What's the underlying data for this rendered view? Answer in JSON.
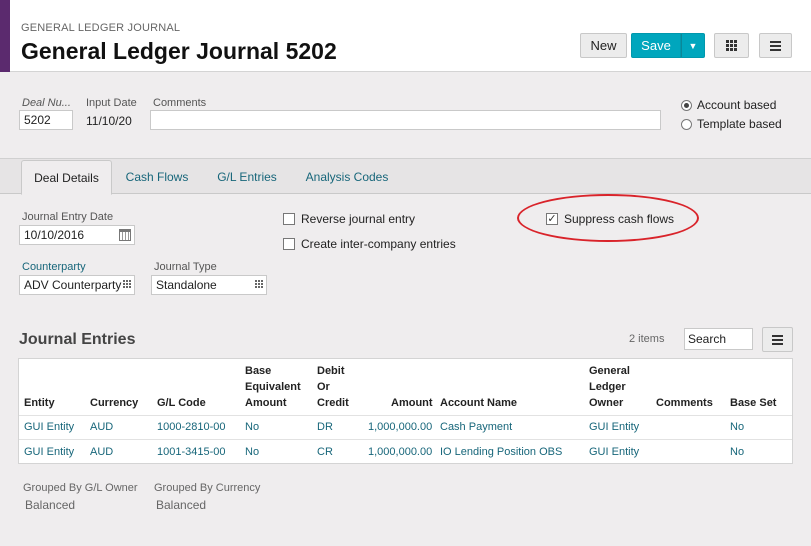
{
  "header": {
    "breadcrumb": "GENERAL LEDGER JOURNAL",
    "title": "General Ledger Journal 5202",
    "buttons": {
      "new": "New",
      "save": "Save"
    }
  },
  "form": {
    "deal_number_label": "Deal Nu...",
    "deal_number_value": "5202",
    "input_date_label": "Input Date",
    "input_date_value": "11/10/20",
    "comments_label": "Comments",
    "comments_value": "",
    "radio_account": "Account based",
    "radio_template": "Template based",
    "selected_radio": "Account based"
  },
  "tabs": [
    {
      "label": "Deal Details",
      "active": true
    },
    {
      "label": "Cash Flows",
      "active": false
    },
    {
      "label": "G/L Entries",
      "active": false
    },
    {
      "label": "Analysis Codes",
      "active": false
    }
  ],
  "deal_details": {
    "journal_entry_date_label": "Journal Entry Date",
    "journal_entry_date_value": "10/10/2016",
    "counterparty_label": "Counterparty",
    "counterparty_value": "ADV Counterparty",
    "journal_type_label": "Journal Type",
    "journal_type_value": "Standalone",
    "reverse_label": "Reverse journal entry",
    "reverse_checked": false,
    "intercompany_label": "Create inter-company entries",
    "intercompany_checked": false,
    "suppress_label": "Suppress cash flows",
    "suppress_checked": true
  },
  "journal_entries": {
    "title": "Journal Entries",
    "count": "2 items",
    "search_placeholder": "Search",
    "columns": [
      "Entity",
      "Currency",
      "G/L Code",
      "Base Equivalent Amount",
      "Debit Or Credit",
      "Amount",
      "Account Name",
      "General Ledger Owner",
      "Comments",
      "Base Set"
    ],
    "rows": [
      [
        "GUI Entity",
        "AUD",
        "1000-2810-00",
        "No",
        "DR",
        "1,000,000.00",
        "Cash Payment",
        "GUI Entity",
        "",
        "No"
      ],
      [
        "GUI Entity",
        "AUD",
        "1001-3415-00",
        "No",
        "CR",
        "1,000,000.00",
        "IO Lending Position OBS",
        "GUI Entity",
        "",
        "No"
      ]
    ],
    "grouped_owner_label": "Grouped By G/L Owner",
    "grouped_owner_value": "Balanced",
    "grouped_currency_label": "Grouped By Currency",
    "grouped_currency_value": "Balanced"
  },
  "colors": {
    "accent": "#5b2a6e",
    "primary_button": "#00a6bd",
    "link": "#17667a",
    "highlight": "#d9232a"
  }
}
